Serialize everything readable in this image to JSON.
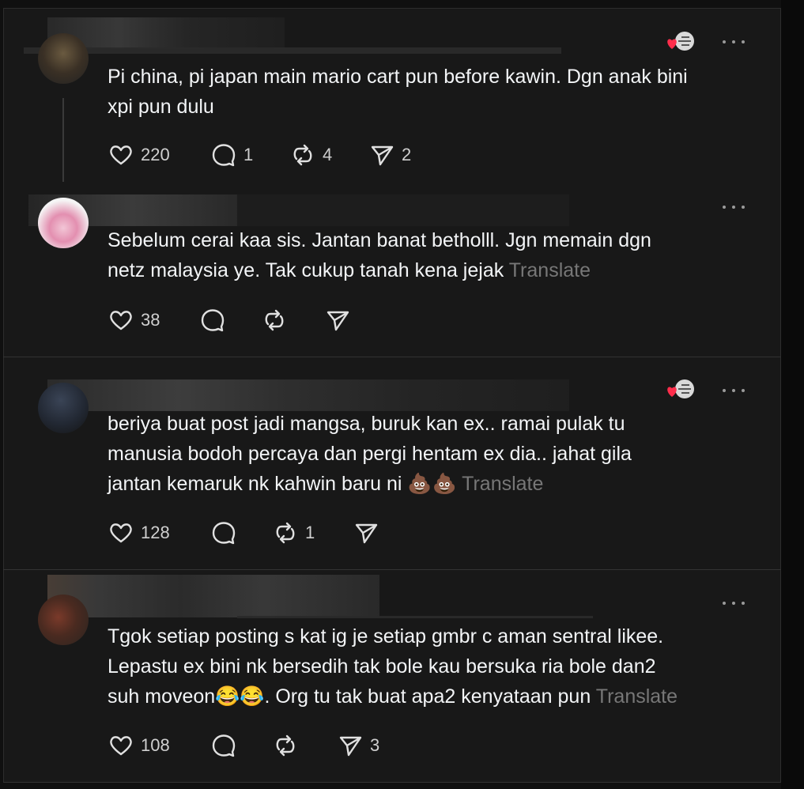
{
  "colors": {
    "background": "#181818",
    "text": "#f3f5f7",
    "muted": "#777777",
    "divider": "#333333"
  },
  "comments": [
    {
      "text": "Pi china, pi japan main mario cart pun before kawin. Dgn anak bini\nxpi pun dulu",
      "translate": "",
      "likes": "220",
      "replies": "1",
      "reposts": "4",
      "shares": "2"
    },
    {
      "text": "Sebelum cerai kaa sis. Jantan banat betholll. Jgn memain dgn\nnetz malaysia ye. Tak cukup tanah kena jejak ",
      "translate": "Translate",
      "likes": "38",
      "replies": "",
      "reposts": "",
      "shares": ""
    },
    {
      "text": "beriya buat post jadi mangsa, buruk kan ex.. ramai pulak tu\nmanusia bodoh percaya dan pergi hentam ex dia.. jahat gila\njantan kemaruk nk kahwin baru ni 💩💩 ",
      "translate": "Translate",
      "likes": "128",
      "replies": "",
      "reposts": "1",
      "shares": ""
    },
    {
      "text": "Tgok setiap posting s kat ig je setiap gmbr c aman sentral likee.\nLepastu ex bini nk bersedih tak bole kau bersuka ria bole dan2\nsuh moveon😂😂. Org tu tak buat apa2 kenyataan pun ",
      "translate": "Translate",
      "likes": "108",
      "replies": "",
      "reposts": "",
      "shares": "3"
    }
  ],
  "icons": {
    "like": "heart-icon",
    "reply": "comment-bubble-icon",
    "repost": "repost-icon",
    "share": "send-icon",
    "more": "more-options-icon",
    "reaction": "liked-by-author-icon"
  }
}
